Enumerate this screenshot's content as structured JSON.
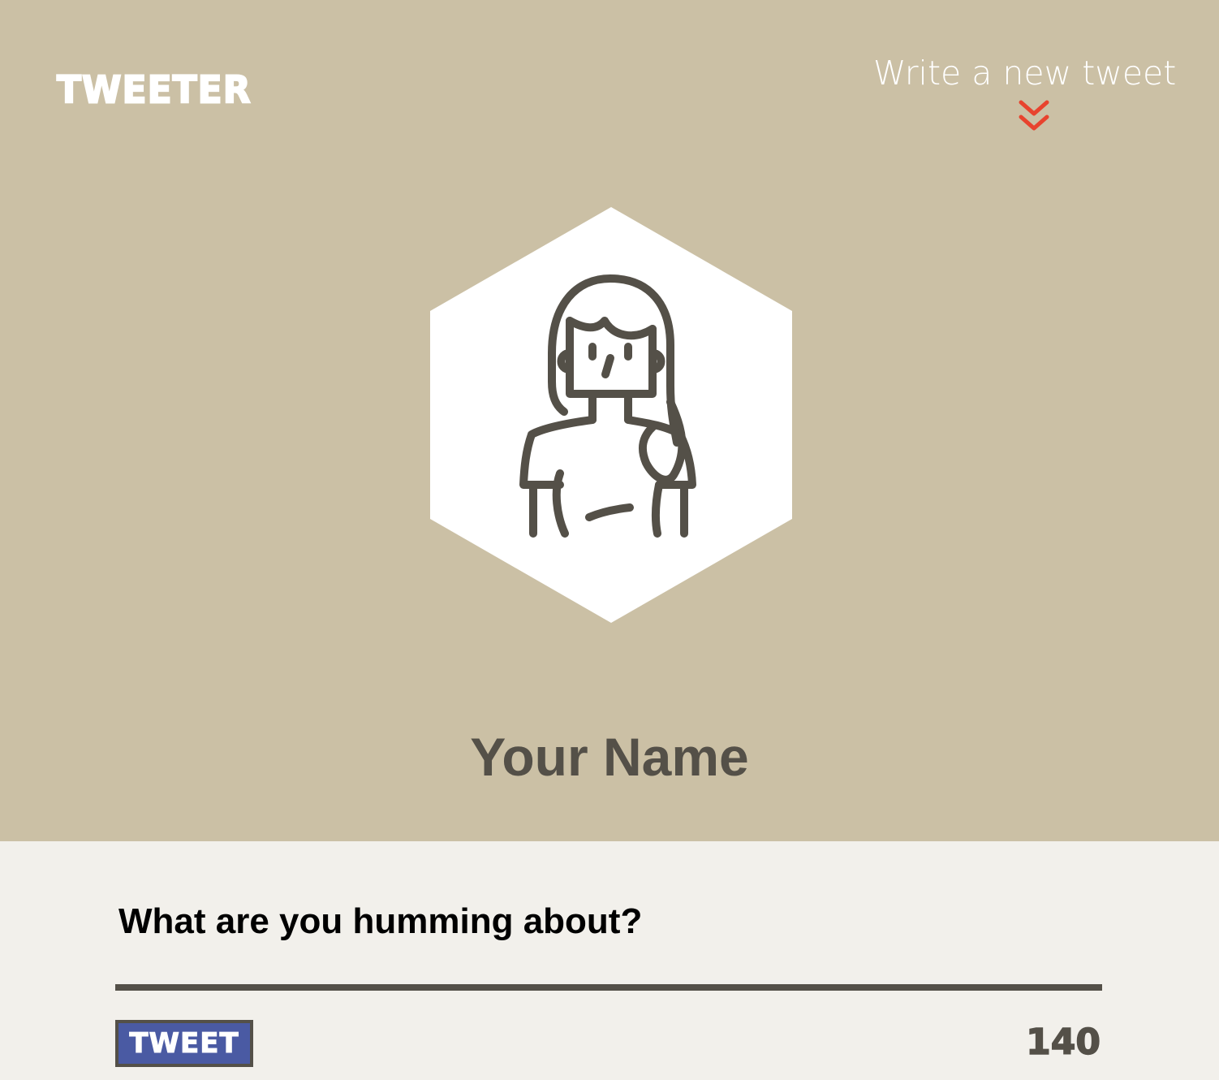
{
  "header": {
    "logo": "TWEETER",
    "write_link": "Write a new tweet",
    "chevron_icon": "double-chevron-down-icon",
    "chevron_color": "#e8432e"
  },
  "profile": {
    "avatar_icon": "woman-avatar-icon",
    "name": "Your Name"
  },
  "composer": {
    "placeholder": "What are you humming about?",
    "tweet_button": "TWEET",
    "char_count": "140"
  },
  "colors": {
    "header_bg": "#cbc0a5",
    "composer_bg": "#f2f0eb",
    "text_dark": "#545048",
    "button_bg": "#4a5aa3"
  }
}
